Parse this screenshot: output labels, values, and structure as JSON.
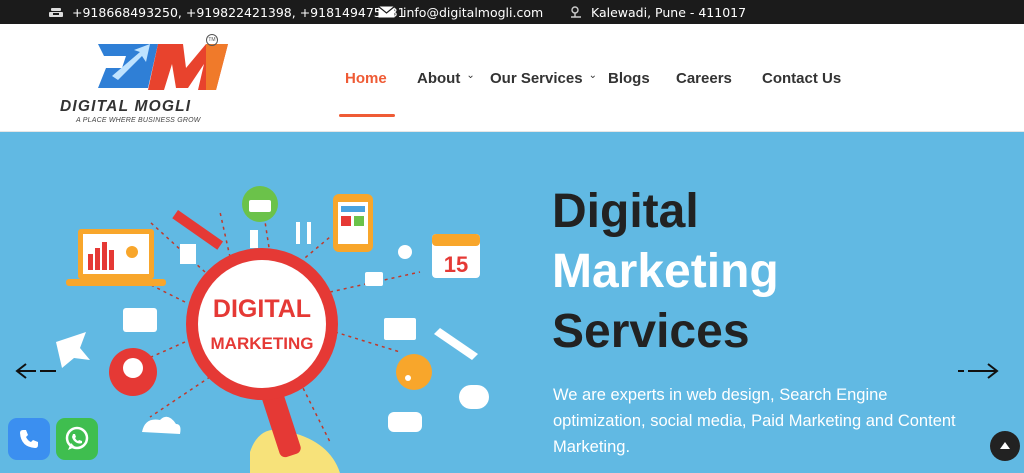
{
  "topbar": {
    "phones": "+918668493250, +919822421398, +918149475031",
    "email": "info@digitalmogli.com",
    "location": "Kalewadi, Pune - 411017"
  },
  "logo": {
    "brand": "DIGITAL MOGLI",
    "tagline": "A PLACE WHERE BUSINESS GROW",
    "tm": "TM"
  },
  "nav": {
    "home": "Home",
    "about": "About",
    "services": "Our Services",
    "blogs": "Blogs",
    "careers": "Careers",
    "contact": "Contact Us",
    "caret": "⌄"
  },
  "hero": {
    "title_line1": "Digital",
    "title_line2": "Marketing",
    "title_line3": "Services",
    "description": "We are experts in web design, Search Engine optimization, social media, Paid Marketing and Content Marketing.",
    "badge_line1": "DIGITAL",
    "badge_line2": "MARKETING",
    "calendar_day": "15"
  },
  "colors": {
    "accent": "#ef5b35",
    "hero_bg": "#61b9e3",
    "topbar_bg": "#1b1b1b"
  },
  "icons": [
    "phone-icon",
    "mail-icon",
    "location-icon",
    "arrow-left-icon",
    "arrow-right-icon",
    "chevron-up-icon",
    "whatsapp-icon"
  ]
}
